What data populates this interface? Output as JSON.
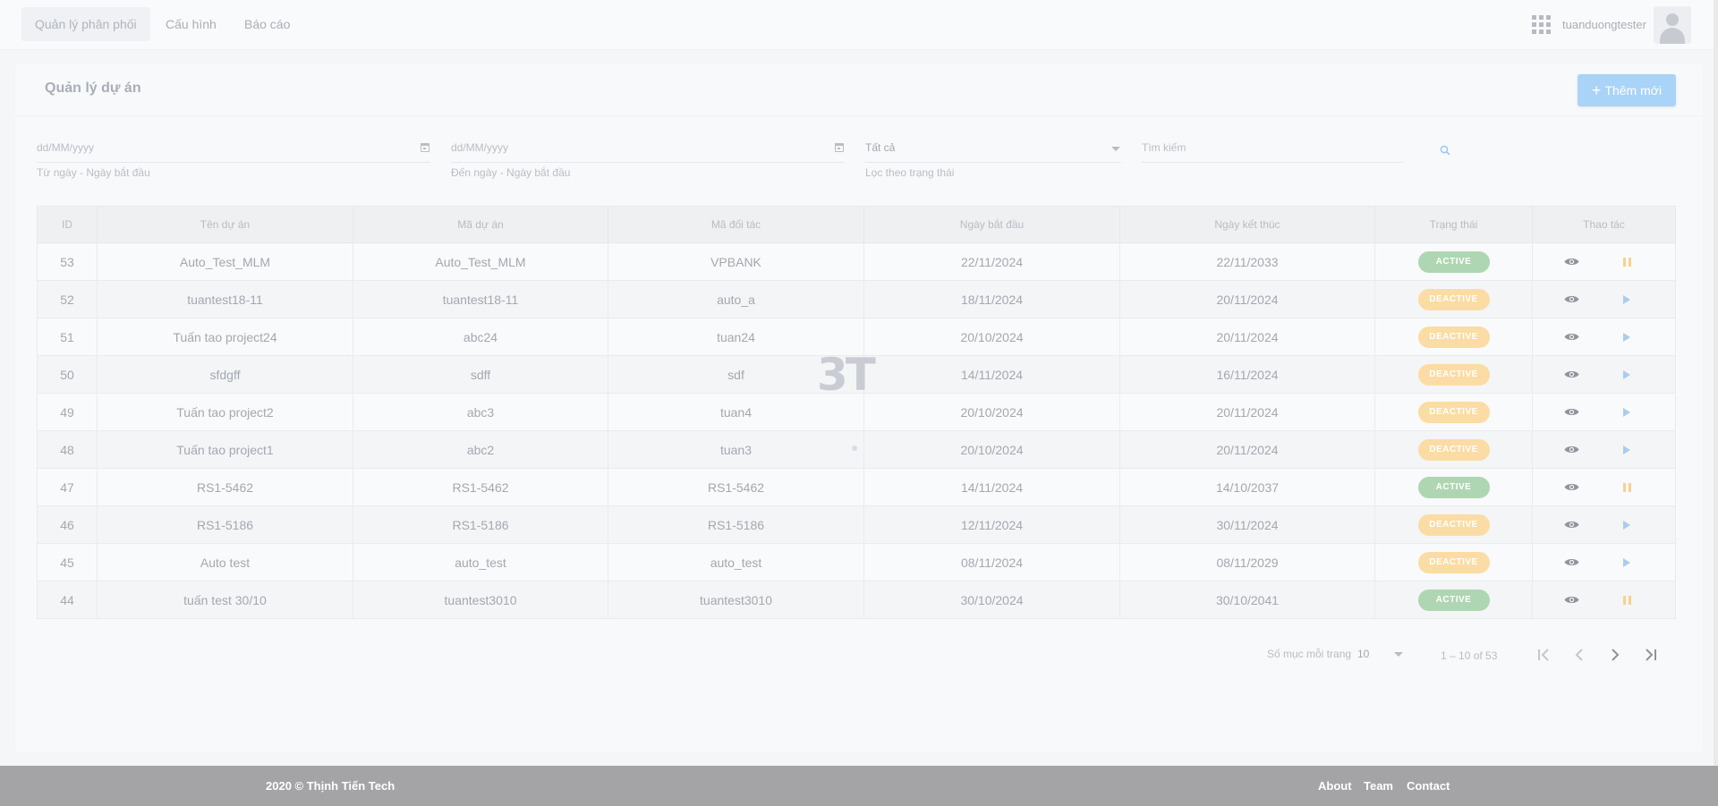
{
  "nav": {
    "items": [
      "Quản lý phân phối",
      "Cấu hình",
      "Báo cáo"
    ],
    "username": "tuanduongtester"
  },
  "page": {
    "title": "Quản lý dự án",
    "add_button": "Thêm mới"
  },
  "filters": {
    "from_date_placeholder": "dd/MM/yyyy",
    "from_date_hint": "Từ ngày - Ngày bắt đầu",
    "to_date_placeholder": "dd/MM/yyyy",
    "to_date_hint": "Đến ngày - Ngày bắt đầu",
    "status_value": "Tất cả",
    "status_hint": "Lọc theo trạng thái",
    "search_placeholder": "Tìm kiếm"
  },
  "table": {
    "headers": [
      "ID",
      "Tên dự án",
      "Mã dự án",
      "Mã đối tác",
      "Ngày bắt đầu",
      "Ngày kết thúc",
      "Trạng thái",
      "Thao tác"
    ],
    "rows": [
      {
        "id": "53",
        "name": "Auto_Test_MLM",
        "code": "Auto_Test_MLM",
        "partner": "VPBANK",
        "start": "22/11/2024",
        "end": "22/11/2033",
        "status": "ACTIVE"
      },
      {
        "id": "52",
        "name": "tuantest18-11",
        "code": "tuantest18-11",
        "partner": "auto_a",
        "start": "18/11/2024",
        "end": "20/11/2024",
        "status": "DEACTIVE"
      },
      {
        "id": "51",
        "name": "Tuấn tao project24",
        "code": "abc24",
        "partner": "tuan24",
        "start": "20/10/2024",
        "end": "20/11/2024",
        "status": "DEACTIVE"
      },
      {
        "id": "50",
        "name": "sfdgff",
        "code": "sdff",
        "partner": "sdf",
        "start": "14/11/2024",
        "end": "16/11/2024",
        "status": "DEACTIVE"
      },
      {
        "id": "49",
        "name": "Tuấn tao project2",
        "code": "abc3",
        "partner": "tuan4",
        "start": "20/10/2024",
        "end": "20/11/2024",
        "status": "DEACTIVE"
      },
      {
        "id": "48",
        "name": "Tuấn tao project1",
        "code": "abc2",
        "partner": "tuan3",
        "start": "20/10/2024",
        "end": "20/11/2024",
        "status": "DEACTIVE"
      },
      {
        "id": "47",
        "name": "RS1-5462",
        "code": "RS1-5462",
        "partner": "RS1-5462",
        "start": "14/11/2024",
        "end": "14/10/2037",
        "status": "ACTIVE"
      },
      {
        "id": "46",
        "name": "RS1-5186",
        "code": "RS1-5186",
        "partner": "RS1-5186",
        "start": "12/11/2024",
        "end": "30/11/2024",
        "status": "DEACTIVE"
      },
      {
        "id": "45",
        "name": "Auto test",
        "code": "auto_test",
        "partner": "auto_test",
        "start": "08/11/2024",
        "end": "08/11/2029",
        "status": "DEACTIVE"
      },
      {
        "id": "44",
        "name": "tuấn test 30/10",
        "code": "tuantest3010",
        "partner": "tuantest3010",
        "start": "30/10/2024",
        "end": "30/10/2041",
        "status": "ACTIVE"
      }
    ]
  },
  "paginator": {
    "label": "Số mục mỗi trang",
    "page_size": "10",
    "range": "1 – 10 of 53"
  },
  "watermark": "3T",
  "footer": {
    "copyright": "2020 © Thịnh Tiến Tech",
    "links": [
      "About",
      "Team",
      "Contact"
    ]
  },
  "colors": {
    "active_badge": "#afd6b2",
    "deactive_badge": "#fbdca4",
    "primary_button": "#a9d3f7",
    "footer_bg": "#a4a4a6"
  }
}
